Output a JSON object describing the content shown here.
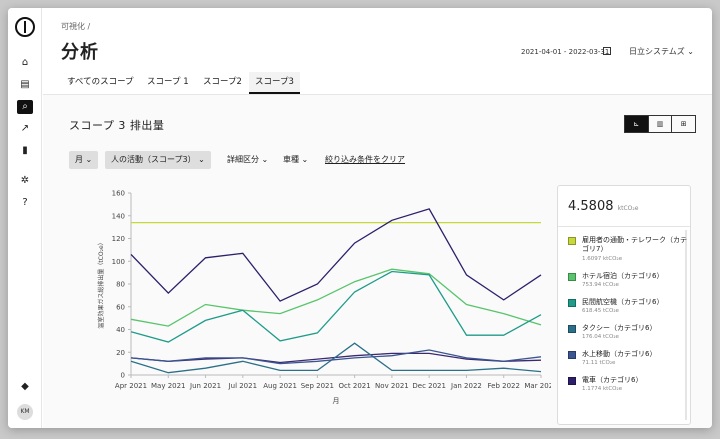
{
  "rail": {
    "icons": [
      "logo-icon",
      "home-icon",
      "document-icon",
      "search-icon",
      "chart-icon",
      "file-icon",
      "gear-icon",
      "help-icon",
      "bell-icon"
    ],
    "avatar": "KM"
  },
  "header": {
    "breadcrumb": "可視化 /",
    "title": "分析",
    "date_range": "2021-04-01 - 2022-03-31",
    "org": "日立システムズ ⌄"
  },
  "tabs": [
    "すべてのスコープ",
    "スコープ 1",
    "スコープ2",
    "スコープ3"
  ],
  "section": {
    "title": "スコープ 3 排出量",
    "view_buttons": [
      "⊾",
      "▥",
      "⊞"
    ]
  },
  "filters": {
    "period": "月 ⌄",
    "activity": "人の活動（スコープ3） ⌄",
    "detail": "詳細区分 ⌄",
    "vehicle": "車種 ⌄",
    "clear": "絞り込み条件をクリア"
  },
  "legend": {
    "total_value": "4.5808",
    "total_unit": "ktCO₂e",
    "items": [
      {
        "name": "雇用者の通勤・テレワーク（カテゴリ7）",
        "value": "1.6097 ktCO₂e",
        "color": "#c6d83a"
      },
      {
        "name": "ホテル宿泊（カテゴリ6）",
        "value": "753.94 tCO₂e",
        "color": "#58c46c"
      },
      {
        "name": "民間航空機（カテゴリ6）",
        "value": "618.45 tCO₂e",
        "color": "#1f9b8a"
      },
      {
        "name": "タクシー（カテゴリ6）",
        "value": "176.04 tCO₂e",
        "color": "#2b6f8a"
      },
      {
        "name": "水上移動（カテゴリ6）",
        "value": "71.11 tCO₂e",
        "color": "#3a5590"
      },
      {
        "name": "電車（カテゴリ6）",
        "value": "1.1774 ktCO₂e",
        "color": "#2e1f6b"
      }
    ]
  },
  "chart_data": {
    "type": "line",
    "xlabel": "月",
    "ylabel": "温室効果ガス総排出量（tCO₂e）",
    "ylim": [
      0,
      160
    ],
    "yticks": [
      0,
      20,
      40,
      60,
      80,
      100,
      120,
      140,
      160
    ],
    "categories": [
      "Apr 2021",
      "May 2021",
      "Jun 2021",
      "Jul 2021",
      "Aug 2021",
      "Sep 2021",
      "Oct 2021",
      "Nov 2021",
      "Dec 2021",
      "Jan 2022",
      "Feb 2022",
      "Mar 2022"
    ],
    "series": [
      {
        "name": "雇用者の通勤・テレワーク（カテゴリ7）",
        "color": "#c6d83a",
        "values": [
          134,
          134,
          134,
          134,
          134,
          134,
          134,
          134,
          134,
          134,
          134,
          134
        ]
      },
      {
        "name": "ホテル宿泊（カテゴリ6）",
        "color": "#58c46c",
        "values": [
          49,
          43,
          62,
          57,
          54,
          66,
          82,
          93,
          89,
          62,
          54,
          44
        ]
      },
      {
        "name": "民間航空機（カテゴリ6）",
        "color": "#1f9b8a",
        "values": [
          38,
          29,
          48,
          57,
          30,
          37,
          73,
          91,
          88,
          35,
          35,
          53
        ]
      },
      {
        "name": "タクシー（カテゴリ6）",
        "color": "#2b6f8a",
        "values": [
          12,
          2,
          6,
          12,
          4,
          4,
          28,
          4,
          4,
          4,
          6,
          3
        ]
      },
      {
        "name": "水上移動（カテゴリ6）",
        "color": "#3a5590",
        "values": [
          15,
          12,
          15,
          15,
          10,
          12,
          15,
          17,
          22,
          15,
          12,
          16
        ]
      },
      {
        "name": "電車（カテゴリ6）",
        "color": "#2e1f6b",
        "values": [
          106,
          72,
          103,
          107,
          65,
          80,
          116,
          136,
          146,
          88,
          66,
          88
        ]
      }
    ],
    "series_extra": {
      "name": "",
      "color": "#3b2a70",
      "values": [
        15,
        12,
        14,
        15,
        11,
        14,
        17,
        19,
        19,
        14,
        12,
        13
      ]
    }
  }
}
